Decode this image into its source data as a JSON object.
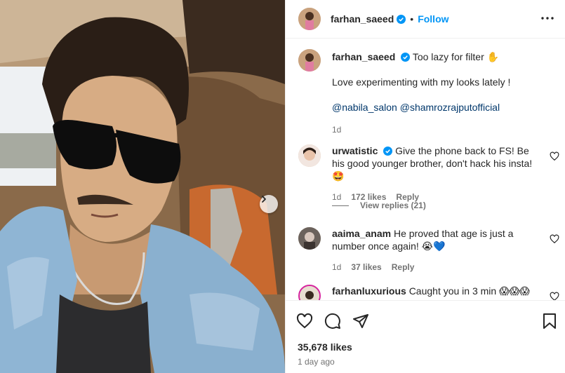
{
  "header": {
    "username": "farhan_saeed",
    "separator": "•",
    "follow_label": "Follow"
  },
  "caption": {
    "username": "farhan_saeed",
    "text": "Too lazy for filter ✋",
    "line2": "Love experimenting with my looks lately !",
    "mention1": "@nabila_salon",
    "mention2": "@shamrozrajputofficial",
    "time": "1d"
  },
  "comments": [
    {
      "username": "urwatistic",
      "verified": true,
      "text": "Give the phone back to FS! Be his good younger brother, don't hack his insta!🤩",
      "time": "1d",
      "likes": "172 likes",
      "reply_label": "Reply"
    },
    {
      "username": "aaima_anam",
      "verified": false,
      "text": "He proved that age is just a number once again! 😭💙",
      "time": "1d",
      "likes": "37 likes",
      "reply_label": "Reply"
    },
    {
      "username": "farhanluxurious",
      "verified": false,
      "text": "Caught you in 3 min 😱😱😱"
    }
  ],
  "view_replies": "View replies (21)",
  "footer": {
    "likes": "35,678 likes",
    "posted": "1 day ago"
  },
  "icons": {
    "like": "heart-icon",
    "comment": "comment-icon",
    "share": "share-icon",
    "save": "bookmark-icon",
    "more": "more-options-icon",
    "next": "chevron-right-icon"
  },
  "colors": {
    "accent": "#0095f6",
    "verified": "#0095f6",
    "mention": "#00376b",
    "muted": "#737373"
  }
}
